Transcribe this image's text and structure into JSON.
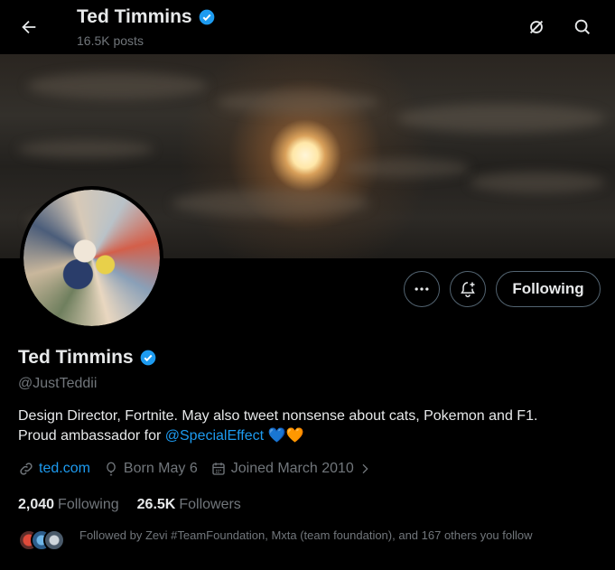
{
  "header": {
    "name": "Ted Timmins",
    "posts": "16.5K posts"
  },
  "profile": {
    "name": "Ted Timmins",
    "handle": "@JustTeddii",
    "bio_line1": "Design Director, Fortnite. May also tweet nonsense about cats, Pokemon and F1.",
    "bio_line2_prefix": "Proud ambassador for ",
    "bio_mention": "@SpecialEffect",
    "bio_emoji": "💙🧡",
    "website": "ted.com",
    "born": "Born May 6",
    "joined": "Joined March 2010",
    "following_count": "2,040",
    "following_label": "Following",
    "followers_count": "26.5K",
    "followers_label": "Followers",
    "followed_by": "Followed by Zevi #TeamFoundation, Mxta (team foundation), and 167 others you follow"
  },
  "actions": {
    "follow_label": "Following"
  },
  "icons": {
    "back": "arrow-left-icon",
    "grok": "grok-icon",
    "search": "search-icon",
    "more": "more-icon",
    "notify": "bell-plus-icon",
    "verified": "verified-badge-icon",
    "link": "link-icon",
    "birth": "balloon-icon",
    "calendar": "calendar-icon"
  },
  "colors": {
    "accent": "#1d9bf0",
    "muted": "#71767b",
    "text": "#e7e9ea",
    "background": "#000000"
  }
}
